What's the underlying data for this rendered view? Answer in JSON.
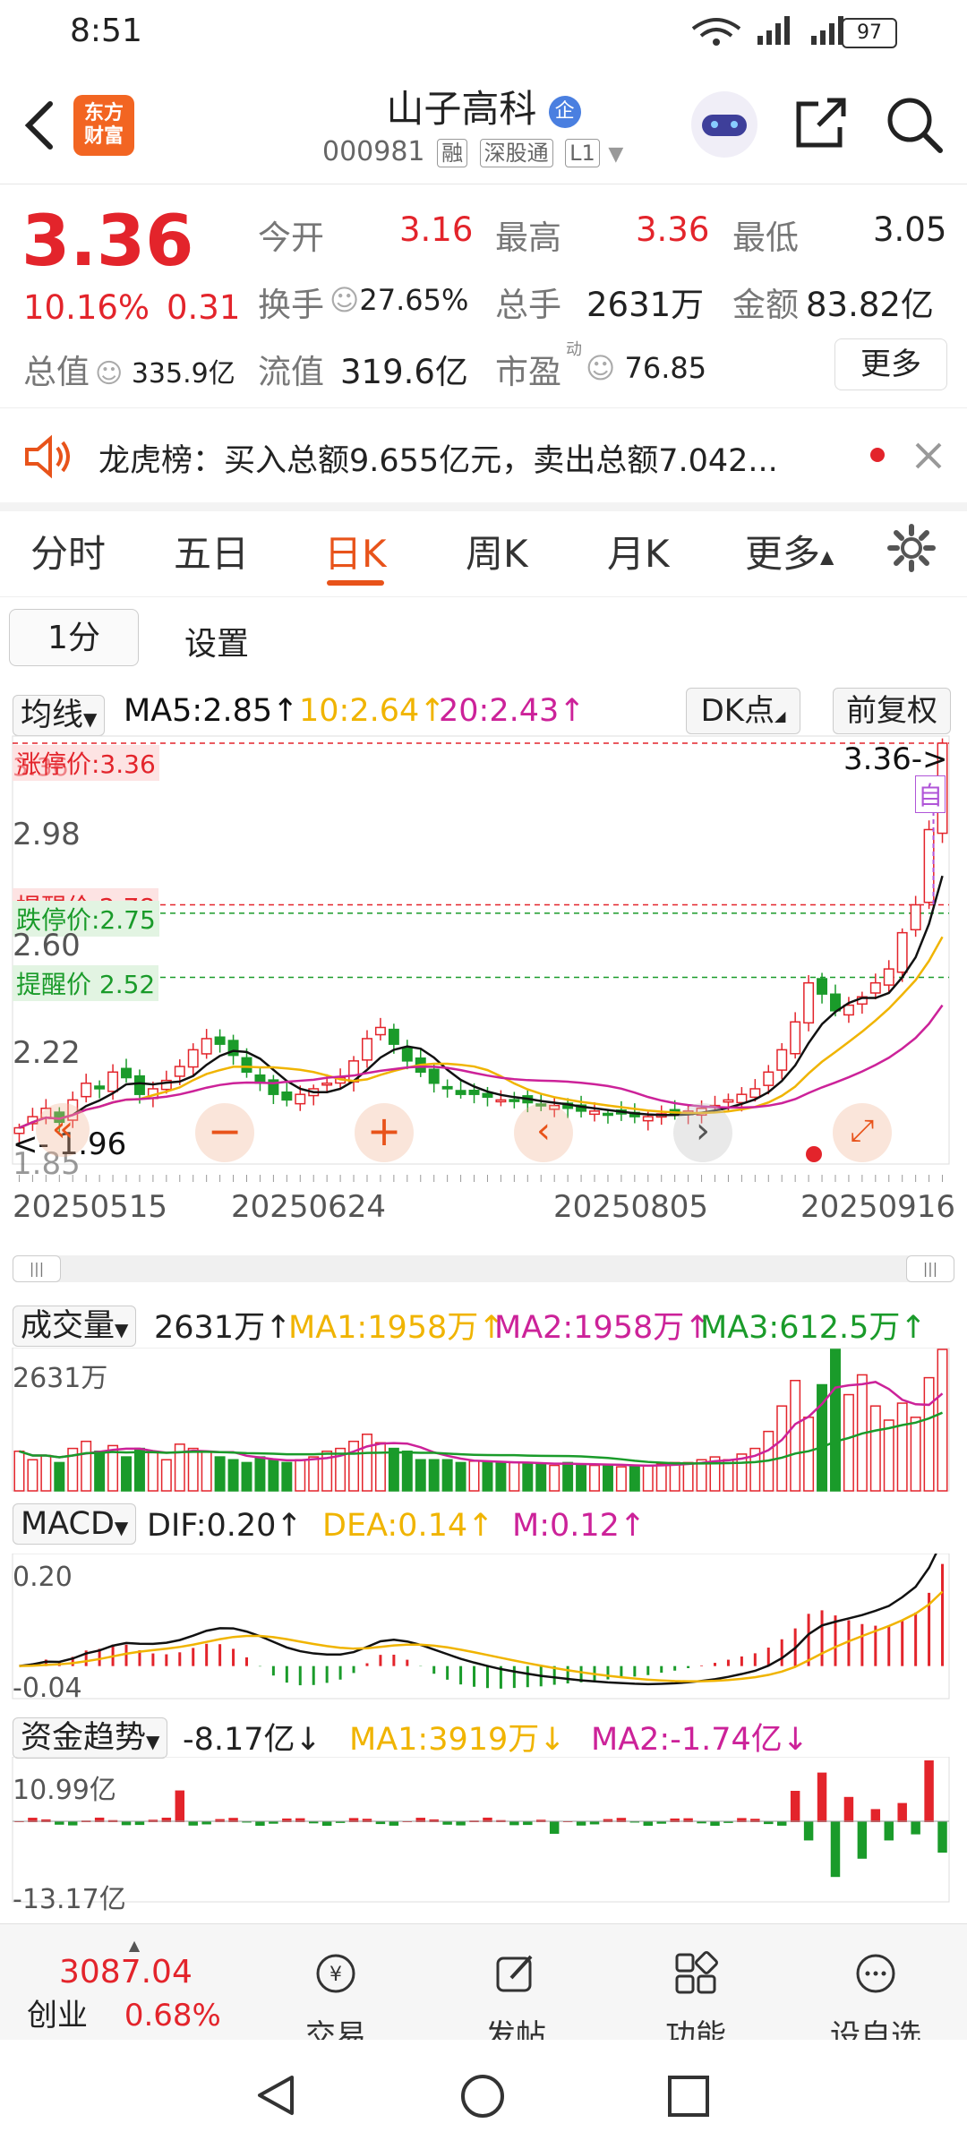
{
  "status_bar": {
    "time": "8:51",
    "battery": "97"
  },
  "header": {
    "logo_text": "东方\n财富",
    "stock_name": "山子高科",
    "badge": "企",
    "code": "000981",
    "tags": [
      "融",
      "深股通",
      "L1"
    ]
  },
  "quote": {
    "price": "3.36",
    "change_pct": "10.16%",
    "change": "0.31",
    "open_label": "今开",
    "open": "3.16",
    "high_label": "最高",
    "high": "3.36",
    "low_label": "最低",
    "low": "3.05",
    "turnover_label": "换手",
    "turnover": "27.65%",
    "volume_label": "总手",
    "volume": "2631万",
    "amount_label": "金额",
    "amount": "83.82亿",
    "mktcap_label": "总值",
    "mktcap": "335.9亿",
    "float_label": "流值",
    "float": "319.6亿",
    "pe_label": "市盈",
    "pe_sup": "动",
    "pe": "76.85",
    "more_button": "更多"
  },
  "alert": {
    "text": "龙虎榜：买入总额9.655亿元，卖出总额7.042..."
  },
  "tabs": [
    "分时",
    "五日",
    "日K",
    "周K",
    "月K",
    "更多"
  ],
  "sub_controls": {
    "period": "1分",
    "settings": "设置"
  },
  "kline": {
    "ma_dropdown": "均线",
    "ma5": "MA5:2.85↑",
    "ma10": "10:2.64↑",
    "ma20": "20:2.43↑",
    "dk_button": "DK点",
    "adjust_button": "前复权",
    "limit_up_label": "涨停价:3.36",
    "limit_down_label": "跌停价:2.75",
    "alert_label_1": "提醒价 2.78",
    "alert_label_2": "提醒价 2.52",
    "top_axis_label": "3.36",
    "current_tag": "3.36->",
    "self_tag": "自",
    "y_labels": [
      "2.98",
      "2.60",
      "2.22",
      "1.85"
    ],
    "min_label": "1.96",
    "min_arrow": "<-",
    "dates": [
      "20250515",
      "20250624",
      "20250805",
      "20250916"
    ]
  },
  "chart_data": [
    {
      "type": "candlestick",
      "title": "日K",
      "ylim": [
        1.85,
        3.36
      ],
      "x_ticks": [
        "20250515",
        "20250624",
        "20250805",
        "20250916"
      ],
      "close": [
        1.98,
        2.02,
        2.05,
        2.0,
        2.08,
        2.14,
        2.12,
        2.18,
        2.16,
        2.1,
        2.12,
        2.15,
        2.2,
        2.26,
        2.3,
        2.28,
        2.24,
        2.18,
        2.14,
        2.1,
        2.08,
        2.1,
        2.12,
        2.14,
        2.16,
        2.22,
        2.3,
        2.34,
        2.28,
        2.22,
        2.18,
        2.14,
        2.12,
        2.1,
        2.1,
        2.09,
        2.08,
        2.08,
        2.07,
        2.06,
        2.06,
        2.05,
        2.04,
        2.04,
        2.03,
        2.03,
        2.02,
        2.02,
        2.03,
        2.03,
        2.04,
        2.05,
        2.06,
        2.08,
        2.1,
        2.12,
        2.18,
        2.26,
        2.36,
        2.5,
        2.46,
        2.4,
        2.42,
        2.45,
        2.5,
        2.55,
        2.68,
        2.78,
        3.05,
        3.36
      ],
      "ma5": "2.85",
      "ma10": "2.64",
      "ma20": "2.43"
    },
    {
      "type": "bar",
      "title": "成交量",
      "max_label": "2631万",
      "values": [
        0.28,
        0.22,
        0.25,
        0.2,
        0.3,
        0.35,
        0.28,
        0.32,
        0.24,
        0.3,
        0.27,
        0.22,
        0.33,
        0.3,
        0.28,
        0.24,
        0.22,
        0.2,
        0.24,
        0.22,
        0.2,
        0.22,
        0.24,
        0.28,
        0.3,
        0.35,
        0.4,
        0.34,
        0.3,
        0.28,
        0.22,
        0.22,
        0.22,
        0.2,
        0.21,
        0.2,
        0.2,
        0.2,
        0.19,
        0.19,
        0.18,
        0.2,
        0.19,
        0.18,
        0.18,
        0.17,
        0.18,
        0.18,
        0.19,
        0.2,
        0.2,
        0.22,
        0.24,
        0.22,
        0.26,
        0.3,
        0.42,
        0.6,
        0.78,
        0.52,
        0.75,
        1.0,
        0.68,
        0.82,
        0.6,
        0.5,
        0.62,
        0.52,
        0.8,
        1.0
      ]
    },
    {
      "type": "bar",
      "title": "MACD",
      "top_label": "0.20",
      "bottom_label": "-0.04"
    },
    {
      "type": "bar",
      "title": "资金趋势",
      "top_label": "10.99亿",
      "bottom_label": "-13.17亿"
    }
  ],
  "volume": {
    "label": "成交量",
    "value": "2631万↑",
    "ma1": "MA1:1958万↑",
    "ma2": "MA2:1958万↑",
    "ma3": "MA3:612.5万↑",
    "top_label": "2631万"
  },
  "macd": {
    "label": "MACD",
    "dif": "DIF:0.20↑",
    "dea": "DEA:0.14↑",
    "m": "M:0.12↑",
    "top_label": "0.20",
    "bottom_label": "-0.04"
  },
  "fund": {
    "label": "资金趋势",
    "value": "-8.17亿↓",
    "ma1": "MA1:3919万↓",
    "ma2": "MA2:-1.74亿↓",
    "top_label": "10.99亿",
    "bottom_label": "-13.17亿"
  },
  "bottom_nav": {
    "index_value": "3087.04",
    "index_name": "创业",
    "index_change": "0.68%",
    "items": [
      "交易",
      "发帖",
      "功能",
      "设自选"
    ]
  },
  "colors": {
    "up": "#e3242b",
    "down": "#1a9b2a",
    "accent": "#e8531a",
    "ma5": "#111111",
    "ma10": "#f0b400",
    "ma20": "#cc2299"
  }
}
